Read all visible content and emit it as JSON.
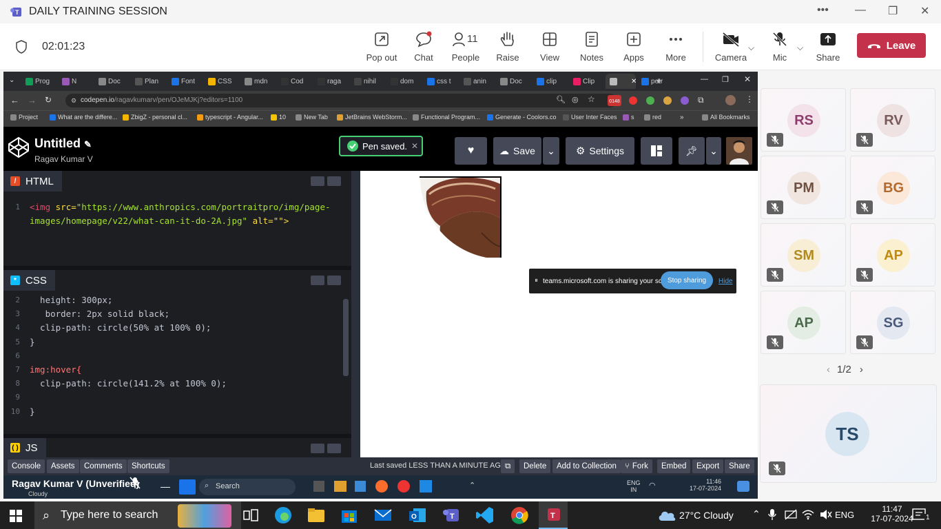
{
  "teams": {
    "title": "DAILY TRAINING SESSION",
    "timer": "02:01:23",
    "controls": [
      {
        "label": "Pop out",
        "icon": "pop-out-icon"
      },
      {
        "label": "Chat",
        "icon": "chat-icon"
      },
      {
        "label": "People",
        "icon": "people-icon",
        "count": "11"
      },
      {
        "label": "Raise",
        "icon": "raise-hand-icon"
      },
      {
        "label": "View",
        "icon": "view-icon"
      },
      {
        "label": "Notes",
        "icon": "notes-icon"
      },
      {
        "label": "Apps",
        "icon": "apps-icon"
      },
      {
        "label": "More",
        "icon": "more-icon"
      },
      {
        "label": "Camera",
        "icon": "camera-off-icon"
      },
      {
        "label": "Mic",
        "icon": "mic-off-icon"
      },
      {
        "label": "Share",
        "icon": "share-icon"
      }
    ],
    "leave_label": "Leave",
    "accent": "#c4314b"
  },
  "browser": {
    "tabs": [
      "Prog",
      "N",
      "Doc",
      "Plan",
      "Font",
      "CSS",
      "mdn",
      "Cod",
      "raga",
      "nihil",
      "dom",
      "css t",
      "anin",
      "Doc",
      "clip",
      "Clip",
      "",
      "potr"
    ],
    "url_host": "codepen.io",
    "url_path": "/ragavkumarv/pen/OJeMJKj?editors=1100",
    "badge": "0148",
    "bookmarks": [
      "Project",
      "What are the differe...",
      "ZbigZ - personal cl...",
      "typescript - Angular...",
      "10",
      "New Tab",
      "JetBrains WebStorm...",
      "Functional Program...",
      "Generate - Coolors.co",
      "User Inter Faces",
      "s",
      "red"
    ],
    "all_bookmarks": "All Bookmarks"
  },
  "codepen": {
    "title": "Untitled",
    "user": "Ragav Kumar V",
    "toast": "Pen saved.",
    "save_label": "Save",
    "settings_label": "Settings",
    "html_tab": "HTML",
    "css_tab": "CSS",
    "js_tab": "JS",
    "html_lines": [
      {
        "n": "1",
        "tag_open": "<img ",
        "attr": "src=",
        "str": "\"https://www.anthropics.com/portraitpro/img/page-",
        "rest": ""
      },
      {
        "n": "",
        "tag_open": "",
        "attr": "",
        "str": "images/homepage/v22/what-can-it-do-2A.jpg\"",
        "rest": " alt=\"\">"
      }
    ],
    "css_lines": [
      {
        "n": "2",
        "text": "  height: 300px;"
      },
      {
        "n": "3",
        "text": "   border: 2px solid black;"
      },
      {
        "n": "4",
        "text": "  clip-path: circle(50% at 100% 0);"
      },
      {
        "n": "5",
        "text": "}"
      },
      {
        "n": "6",
        "text": ""
      },
      {
        "n": "7",
        "text": "img:hover{"
      },
      {
        "n": "8",
        "text": "  clip-path: circle(141.2% at 100% 0);"
      },
      {
        "n": "9",
        "text": ""
      },
      {
        "n": "10",
        "text": "}"
      }
    ],
    "footer_buttons": [
      "Console",
      "Assets",
      "Comments",
      "Shortcuts"
    ],
    "footer_right": [
      "Delete",
      "Add to Collection",
      "Fork",
      "Embed",
      "Export",
      "Share"
    ],
    "last_saved": "Last saved LESS THAN A MINUTE AGO"
  },
  "sharebar": {
    "text": "teams.microsoft.com is sharing your screen.",
    "stop": "Stop sharing",
    "hide": "Hide"
  },
  "presenter": {
    "name": "Ragav Kumar V (Unverified)",
    "weather": "Cloudy",
    "search": "Search",
    "lang": "ENG",
    "region": "IN",
    "time": "11:46",
    "date": "17-07-2024"
  },
  "participants": [
    {
      "initials": "RS",
      "color": "#8e3c6e",
      "bg": "#f3e2ea"
    },
    {
      "initials": "RV",
      "color": "#7a5a5a",
      "bg": "#eee2e2"
    },
    {
      "initials": "PM",
      "color": "#6e5040",
      "bg": "#f1e5e0"
    },
    {
      "initials": "BG",
      "color": "#b06a30",
      "bg": "#fbe8d8"
    },
    {
      "initials": "SM",
      "color": "#b08a20",
      "bg": "#f8eed6"
    },
    {
      "initials": "AP",
      "color": "#c08a10",
      "bg": "#fbf0d0"
    },
    {
      "initials": "AP",
      "color": "#4a6a4a",
      "bg": "#e4ede4"
    },
    {
      "initials": "SG",
      "color": "#4a5a7a",
      "bg": "#e4e8f0"
    }
  ],
  "self_tile": {
    "initials": "TS",
    "color": "#2a4a6a",
    "bg": "#d8e6f2"
  },
  "pager": "1/2",
  "taskbar": {
    "search_placeholder": "Type here to search",
    "weather": "27°C  Cloudy",
    "lang": "ENG",
    "time": "11:47",
    "date": "17-07-2024",
    "notif": "1"
  }
}
